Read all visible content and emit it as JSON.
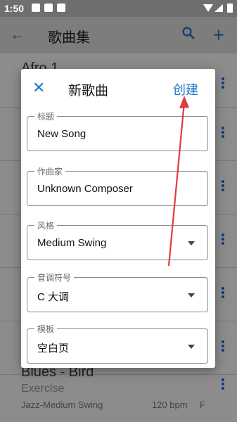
{
  "status": {
    "time": "1:50"
  },
  "appbar": {
    "title": "歌曲集",
    "back_icon": "arrow-left-icon",
    "search_icon": "search-icon",
    "add_icon": "plus-icon",
    "accent": "#123b73"
  },
  "background_list": {
    "partial_top_title": "Afro 1",
    "bottom_item": {
      "title": "Blues - Bird",
      "subtitle": "Exercise",
      "style": "Jazz-Medium Swing",
      "tempo": "120 bpm",
      "key": "F"
    }
  },
  "dialog": {
    "title": "新歌曲",
    "create_label": "创建",
    "close_icon": "close-icon",
    "fields": [
      {
        "label": "标题",
        "value": "New Song"
      },
      {
        "label": "作曲家",
        "value": "Unknown Composer"
      },
      {
        "label": "风格",
        "value": "Medium Swing"
      },
      {
        "label": "音调符号",
        "value": "C 大调"
      },
      {
        "label": "模板",
        "value": "空白页"
      }
    ],
    "accent": "#1e77c8"
  }
}
